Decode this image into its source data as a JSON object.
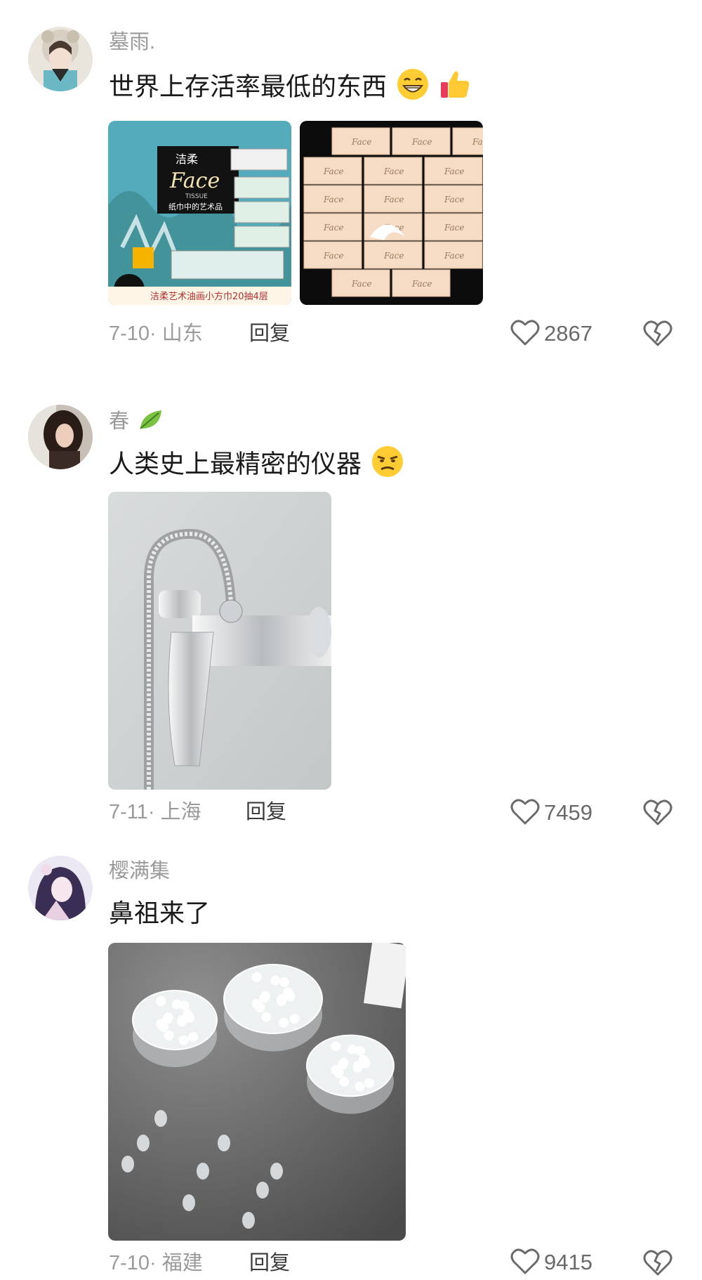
{
  "comments": [
    {
      "username": "墓雨.",
      "text": "世界上存活率最低的东西",
      "date": "7-10",
      "location": "山东",
      "reply_label": "回复",
      "likes": "2867",
      "emojis": [
        "grinning-face",
        "thumbs-up"
      ],
      "images": [
        {
          "caption": "洁柔艺术油画小方巾20抽4层",
          "brand": "洁柔",
          "product": "Face",
          "sub": "TISSUE",
          "tagline": "纸巾中的艺术品"
        },
        {
          "product": "Face"
        }
      ]
    },
    {
      "username": "春",
      "text": "人类史上最精密的仪器",
      "date": "7-11",
      "location": "上海",
      "reply_label": "回复",
      "likes": "7459",
      "emojis": [
        "unamused-face"
      ],
      "name_emoji": "leaf"
    },
    {
      "username": "樱满集",
      "text": "鼻祖来了",
      "date": "7-10",
      "location": "福建",
      "reply_label": "回复",
      "likes": "9415"
    }
  ],
  "colors": {
    "username": "#9a9a9a",
    "text": "#1a1a1a",
    "meta": "#9a9a9a"
  }
}
